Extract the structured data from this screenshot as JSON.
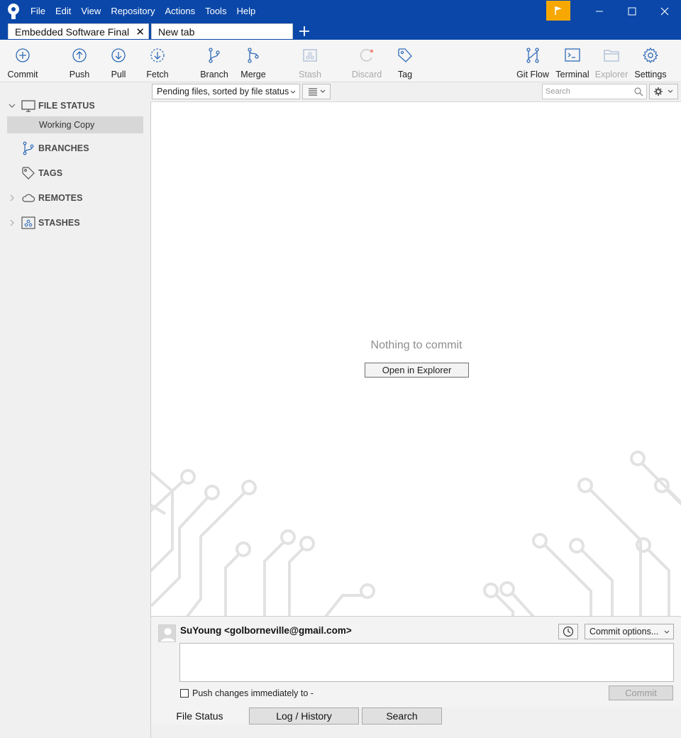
{
  "menu": [
    "File",
    "Edit",
    "View",
    "Repository",
    "Actions",
    "Tools",
    "Help"
  ],
  "tabs": {
    "active": "Embedded Software Final",
    "inactive": "New tab"
  },
  "toolbar": {
    "commit": "Commit",
    "push": "Push",
    "pull": "Pull",
    "fetch": "Fetch",
    "branch": "Branch",
    "merge": "Merge",
    "stash": "Stash",
    "discard": "Discard",
    "tag": "Tag",
    "gitflow": "Git Flow",
    "terminal": "Terminal",
    "explorer": "Explorer",
    "settings": "Settings"
  },
  "sidebar": {
    "file_status": "FILE STATUS",
    "working_copy": "Working Copy",
    "branches": "BRANCHES",
    "tags": "TAGS",
    "remotes": "REMOTES",
    "stashes": "STASHES"
  },
  "filter": {
    "sort": "Pending files, sorted by file status",
    "search_placeholder": "Search"
  },
  "content": {
    "empty_message": "Nothing to commit",
    "open_explorer": "Open in Explorer"
  },
  "commit": {
    "author": "SuYoung <golborneville@gmail.com>",
    "options": "Commit options...",
    "push_label": "Push changes immediately to -",
    "button": "Commit"
  },
  "bottom_tabs": [
    "File Status",
    "Log / History",
    "Search"
  ],
  "colors": {
    "titlebar": "#0a47a9",
    "flag": "#f6a800",
    "icon_blue": "#2f6bb8"
  }
}
